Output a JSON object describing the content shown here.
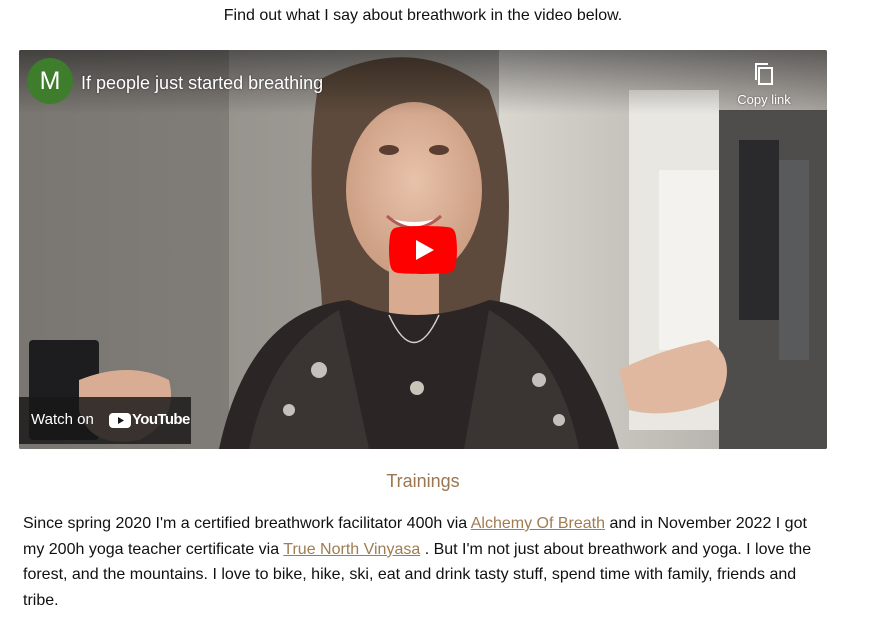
{
  "intro": {
    "text": "Find out what I say about breathwork in the video below."
  },
  "video": {
    "channel_initial": "M",
    "title": "If people just started breathing",
    "copy_link_label": "Copy link",
    "watch_on_label": "Watch on",
    "youtube_wordmark": "YouTube",
    "icons": {
      "copy": "copy-icon",
      "play": "play-icon",
      "youtube": "youtube-logo-icon"
    },
    "colors": {
      "play_red": "#ff0000",
      "avatar_green": "#3d7d2b"
    }
  },
  "trainings": {
    "heading": "Trainings",
    "bio_part1": "Since spring 2020 I'm a certified breathwork facilitator 400h via ",
    "link1": "Alchemy Of Breath",
    "bio_part2": " and in November 2022 I got my 200h yoga teacher certificate via ",
    "link2": "True North Vinyasa",
    "bio_part3": " . But I'm not just about breathwork and yoga. I love the forest, and the mountains. I love to bike, hike, ski, eat and drink tasty stuff, spend time with family, friends and tribe."
  },
  "colors": {
    "heading": "#9b7650",
    "link": "#a07c52"
  }
}
